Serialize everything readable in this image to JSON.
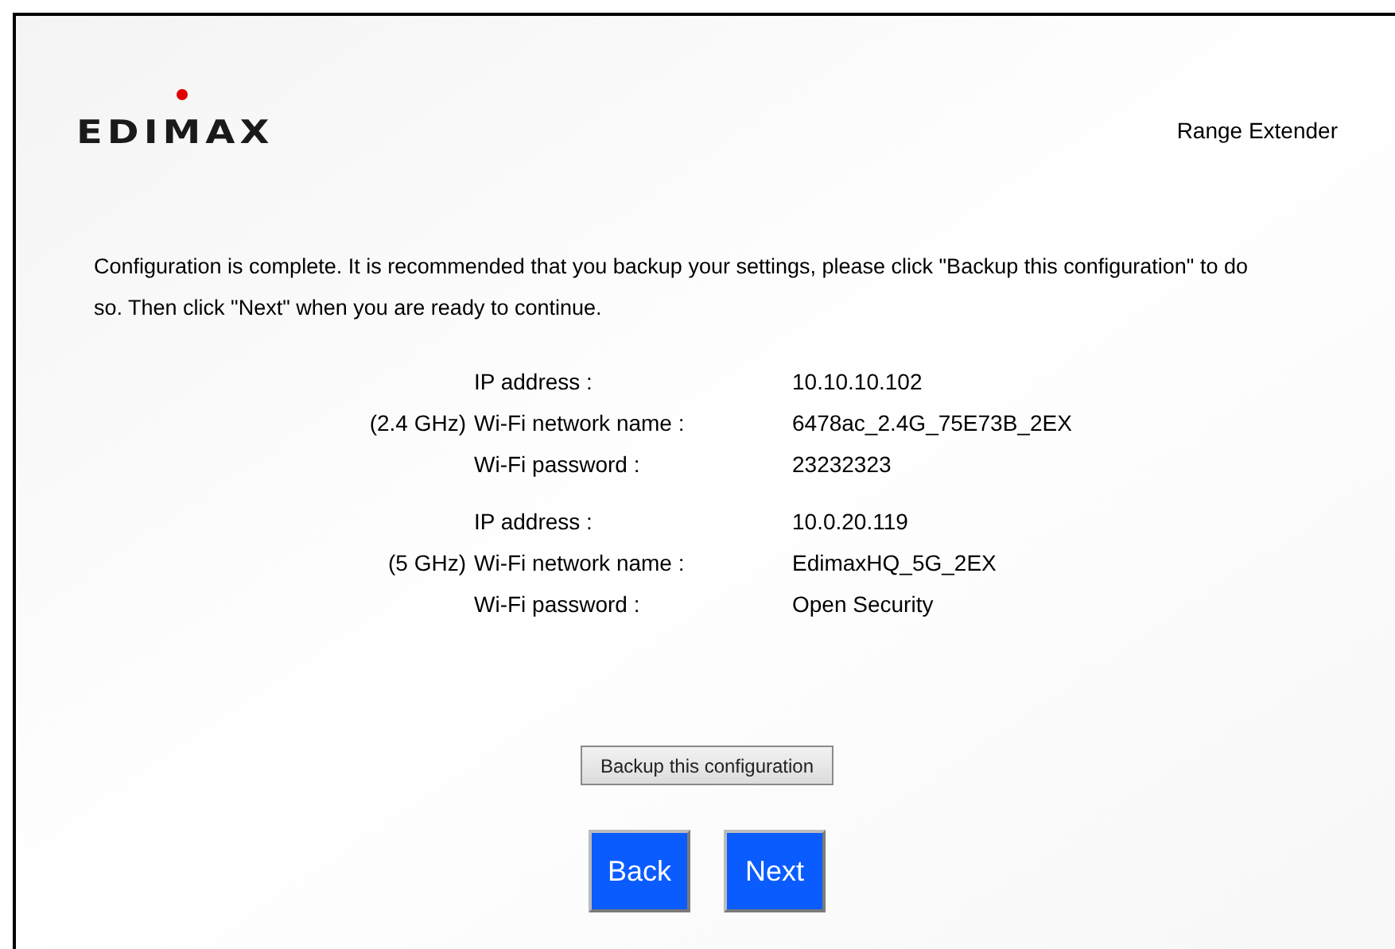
{
  "header": {
    "logo": "EDIMAX",
    "product": "Range Extender"
  },
  "message": "Configuration is complete. It is recommended that you backup your settings, please click \"Backup this configuration\" to do so. Then click \"Next\" when you are ready to continue.",
  "sections": [
    {
      "band": "(2.4 GHz)",
      "rows": [
        {
          "label": "IP address :",
          "value": "10.10.10.102"
        },
        {
          "label": "Wi-Fi network name :",
          "value": "6478ac_2.4G_75E73B_2EX"
        },
        {
          "label": "Wi-Fi password :",
          "value": "23232323"
        }
      ]
    },
    {
      "band": "(5 GHz)",
      "rows": [
        {
          "label": "IP address :",
          "value": "10.0.20.119"
        },
        {
          "label": "Wi-Fi network name :",
          "value": "EdimaxHQ_5G_2EX"
        },
        {
          "label": "Wi-Fi password :",
          "value": "Open Security"
        }
      ]
    }
  ],
  "backup_button": "Backup this configuration",
  "nav_buttons": [
    "Back",
    "Next"
  ]
}
